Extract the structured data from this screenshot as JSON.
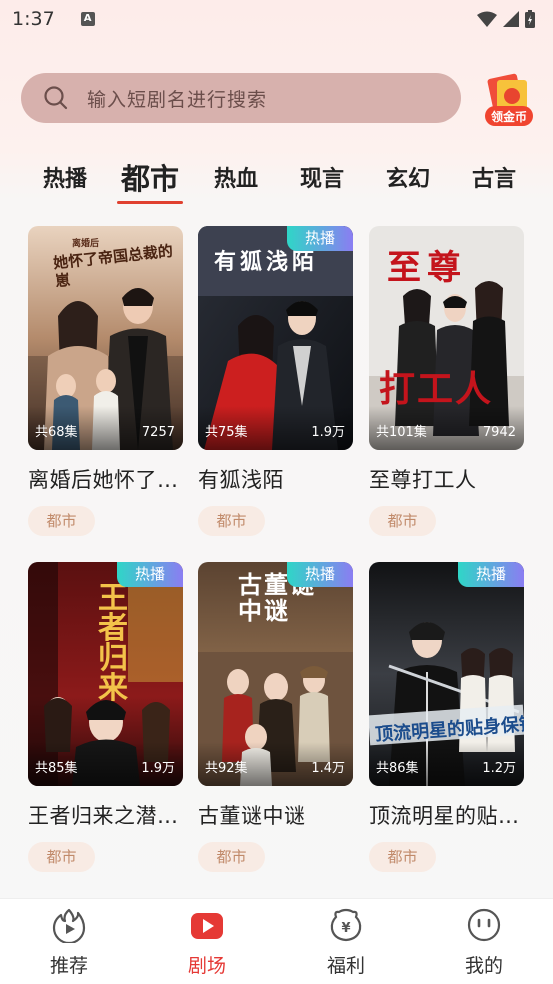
{
  "status_bar": {
    "time": "1:37",
    "notif_icon": "A"
  },
  "search": {
    "placeholder": "输入短剧名进行搜索"
  },
  "coin_button": {
    "label": "领金币"
  },
  "tabs": [
    {
      "label": "热播",
      "active": false
    },
    {
      "label": "都市",
      "active": true
    },
    {
      "label": "热血",
      "active": false
    },
    {
      "label": "现言",
      "active": false
    },
    {
      "label": "玄幻",
      "active": false
    },
    {
      "label": "古言",
      "active": false
    }
  ],
  "dramas": [
    {
      "title": "离婚后她怀了…",
      "episodes": "共68集",
      "views": "7257",
      "genre": "都市",
      "hot": false,
      "poster_text": "她怀了帝国总裁的崽",
      "poster_sub": "离婚后"
    },
    {
      "title": "有狐浅陌",
      "episodes": "共75集",
      "views": "1.9万",
      "genre": "都市",
      "hot": true,
      "hot_label": "热播",
      "poster_text": "有狐浅陌"
    },
    {
      "title": "至尊打工人",
      "episodes": "共101集",
      "views": "7942",
      "genre": "都市",
      "hot": false,
      "poster_text": "至尊",
      "poster_text2": "打工人"
    },
    {
      "title": "王者归来之潜…",
      "episodes": "共85集",
      "views": "1.9万",
      "genre": "都市",
      "hot": true,
      "hot_label": "热播",
      "poster_text": "王者归来"
    },
    {
      "title": "古董谜中谜",
      "episodes": "共92集",
      "views": "1.4万",
      "genre": "都市",
      "hot": true,
      "hot_label": "热播",
      "poster_text": "古董谜中谜"
    },
    {
      "title": "顶流明星的贴…",
      "episodes": "共86集",
      "views": "1.2万",
      "genre": "都市",
      "hot": true,
      "hot_label": "热播",
      "poster_text": "顶流明星的贴身保镖"
    }
  ],
  "bottom_nav": [
    {
      "label": "推荐",
      "icon": "play-flame-icon",
      "active": false
    },
    {
      "label": "剧场",
      "icon": "theater-play-icon",
      "active": true
    },
    {
      "label": "福利",
      "icon": "yuan-piggy-icon",
      "active": false
    },
    {
      "label": "我的",
      "icon": "face-icon",
      "active": false
    }
  ],
  "colors": {
    "accent": "#e53935",
    "search_bg": "#d7b1ad",
    "tag_bg": "#f8ebe4",
    "tag_text": "#c18a6a"
  }
}
